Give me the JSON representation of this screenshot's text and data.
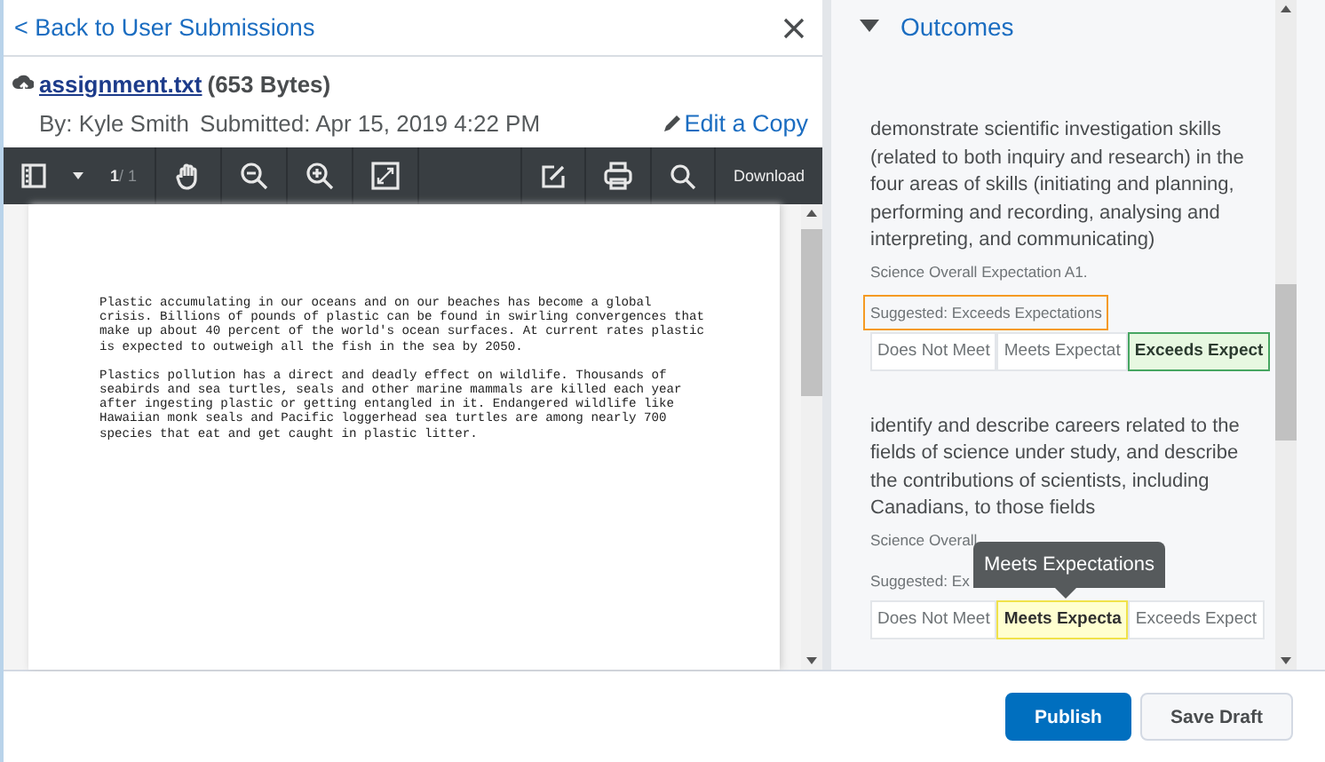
{
  "submission": {
    "back_link": "< Back to User Submissions",
    "file_name": "assignment.txt",
    "file_size": "(653 Bytes)",
    "author": "By: Kyle Smith",
    "submitted": "Submitted: Apr 15, 2019 4:22 PM",
    "edit_link": "Edit a Copy"
  },
  "toolbar": {
    "page_current": "1",
    "page_total": "/ 1",
    "download": "Download"
  },
  "document": {
    "paragraphs": [
      [
        "Plastic accumulating in our oceans and on our beaches has become a global",
        "crisis. Billions of pounds of plastic can be found in swirling convergences that",
        "make up about 40 percent of the world's ocean surfaces. At current rates plastic",
        "is expected to outweigh all the fish in the sea by 2050."
      ],
      [
        "Plastics pollution has a direct and deadly effect on wildlife. Thousands of",
        "seabirds and sea turtles, seals and other marine mammals are killed each year",
        "after ingesting plastic or getting entangled in it. Endangered wildlife like",
        "Hawaiian monk seals and Pacific loggerhead sea turtles are among nearly 700",
        "species that eat and get caught in plastic litter."
      ]
    ]
  },
  "outcomes": {
    "title": "Outcomes",
    "expanded": true,
    "items": [
      {
        "description": "demonstrate scientific investigation skills (related to both inquiry and research) in the four areas of skills (initiating and planning, performing and recording, analysing and interpreting, and communicating)",
        "code": "Science Overall Expectation A1.",
        "suggested": "Suggested: Exceeds Expectations",
        "suggested_focused": true,
        "levels": [
          {
            "label": "Does Not Meet",
            "selected": false,
            "hovered": false
          },
          {
            "label": "Meets Expectat",
            "selected": false,
            "hovered": false
          },
          {
            "label": "Exceeds Expect",
            "selected": true,
            "hovered": false
          }
        ]
      },
      {
        "description": "identify and describe careers related to the fields of science under study, and describe the contributions of scientists, including Canadians, to those fields",
        "code": "Science Overall",
        "suggested": "Suggested: Ex",
        "suggested_focused": false,
        "tooltip": "Meets Expectations",
        "levels": [
          {
            "label": "Does Not Meet",
            "selected": false,
            "hovered": false
          },
          {
            "label": "Meets Expecta",
            "selected": false,
            "hovered": true
          },
          {
            "label": "Exceeds Expect",
            "selected": false,
            "hovered": false
          }
        ]
      }
    ]
  },
  "buttons": [
    {
      "label": "Publish",
      "primary": true
    },
    {
      "label": "Save Draft",
      "primary": false
    }
  ]
}
